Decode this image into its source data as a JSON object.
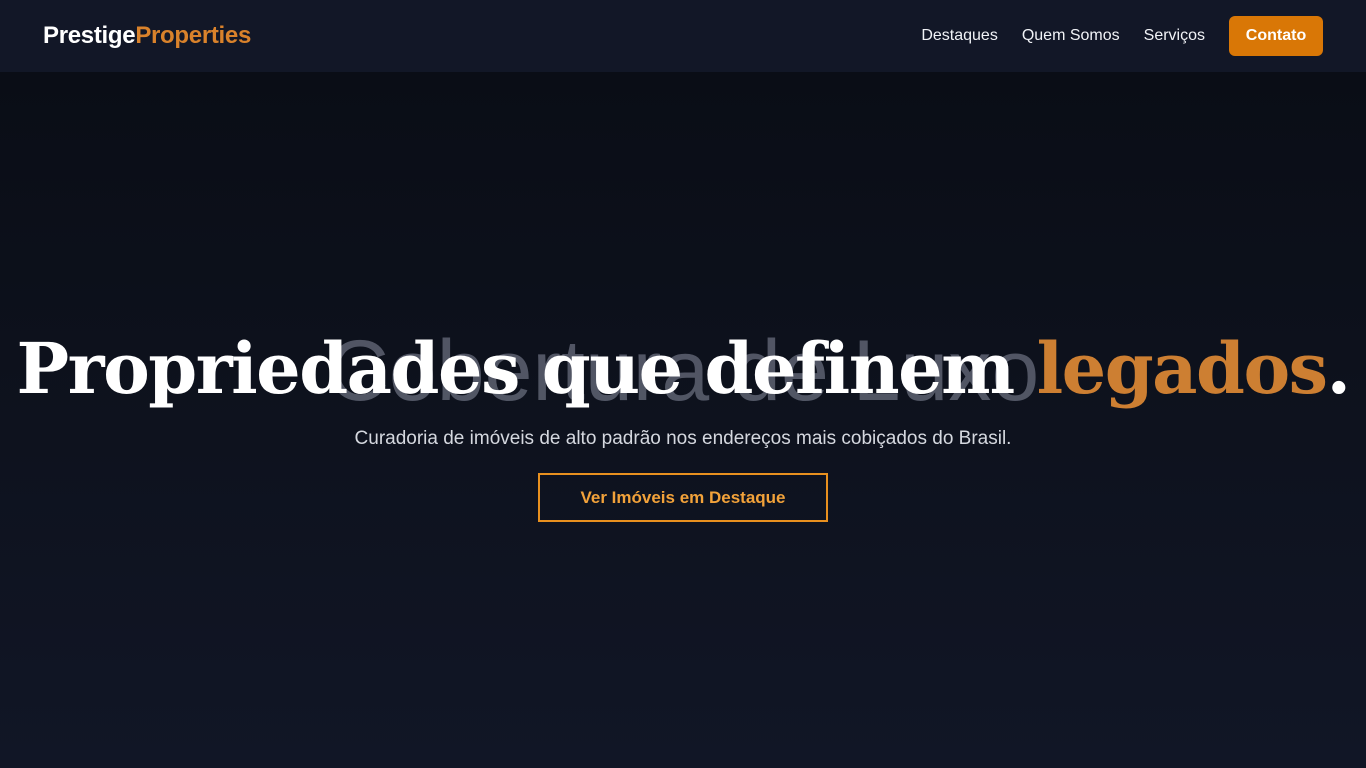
{
  "brand": {
    "part1": "Prestige",
    "part2": "Properties"
  },
  "nav": {
    "links": [
      "Destaques",
      "Quem Somos",
      "Serviços"
    ],
    "contact": "Contato"
  },
  "hero": {
    "background_word": "Cobertura de Luxo",
    "headline_main": "Propriedades que definem ",
    "headline_accent": "legados",
    "headline_end": ".",
    "subtitle": "Curadoria de imóveis de alto padrão nos endereços mais cobiçados do Brasil.",
    "cta": "Ver Imóveis em Destaque"
  },
  "colors": {
    "accent": "#d97706",
    "accent_text": "#cd7f32",
    "background": "#0f1422"
  }
}
